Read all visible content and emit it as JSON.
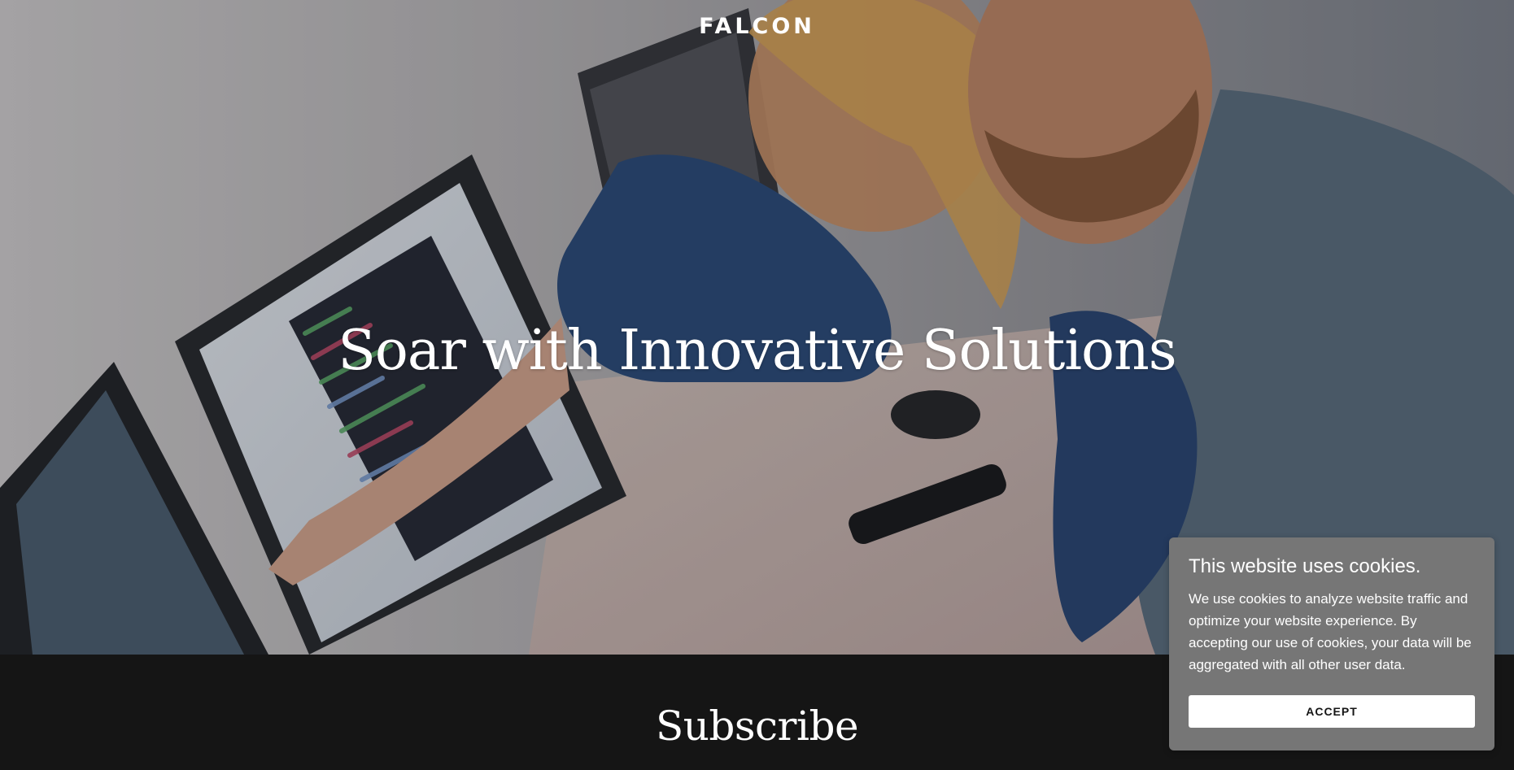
{
  "header": {
    "brand": "FALCON"
  },
  "hero": {
    "title": "Soar with Innovative Solutions"
  },
  "subscribe": {
    "title": "Subscribe"
  },
  "cookie_banner": {
    "title": "This website uses cookies.",
    "body": "We use cookies to analyze website traffic and optimize your website experience. By accepting our use of cookies, your data will be aggregated with all other user data.",
    "accept_label": "ACCEPT",
    "background_color": "#767676"
  },
  "colors": {
    "footer_background": "#151515",
    "text": "#ffffff"
  }
}
